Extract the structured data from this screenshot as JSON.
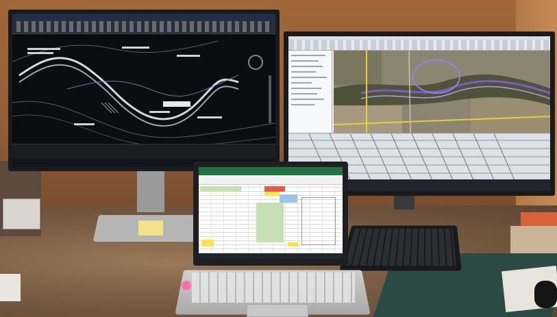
{
  "scene": {
    "description_colors": {
      "wall": "#9a6438",
      "desk": "#7b5e44",
      "cad_background": "#0b0d12",
      "excel_accent": "#217346",
      "map_vegetation": "#6b6a45",
      "map_path": "#7b5cc9"
    }
  }
}
